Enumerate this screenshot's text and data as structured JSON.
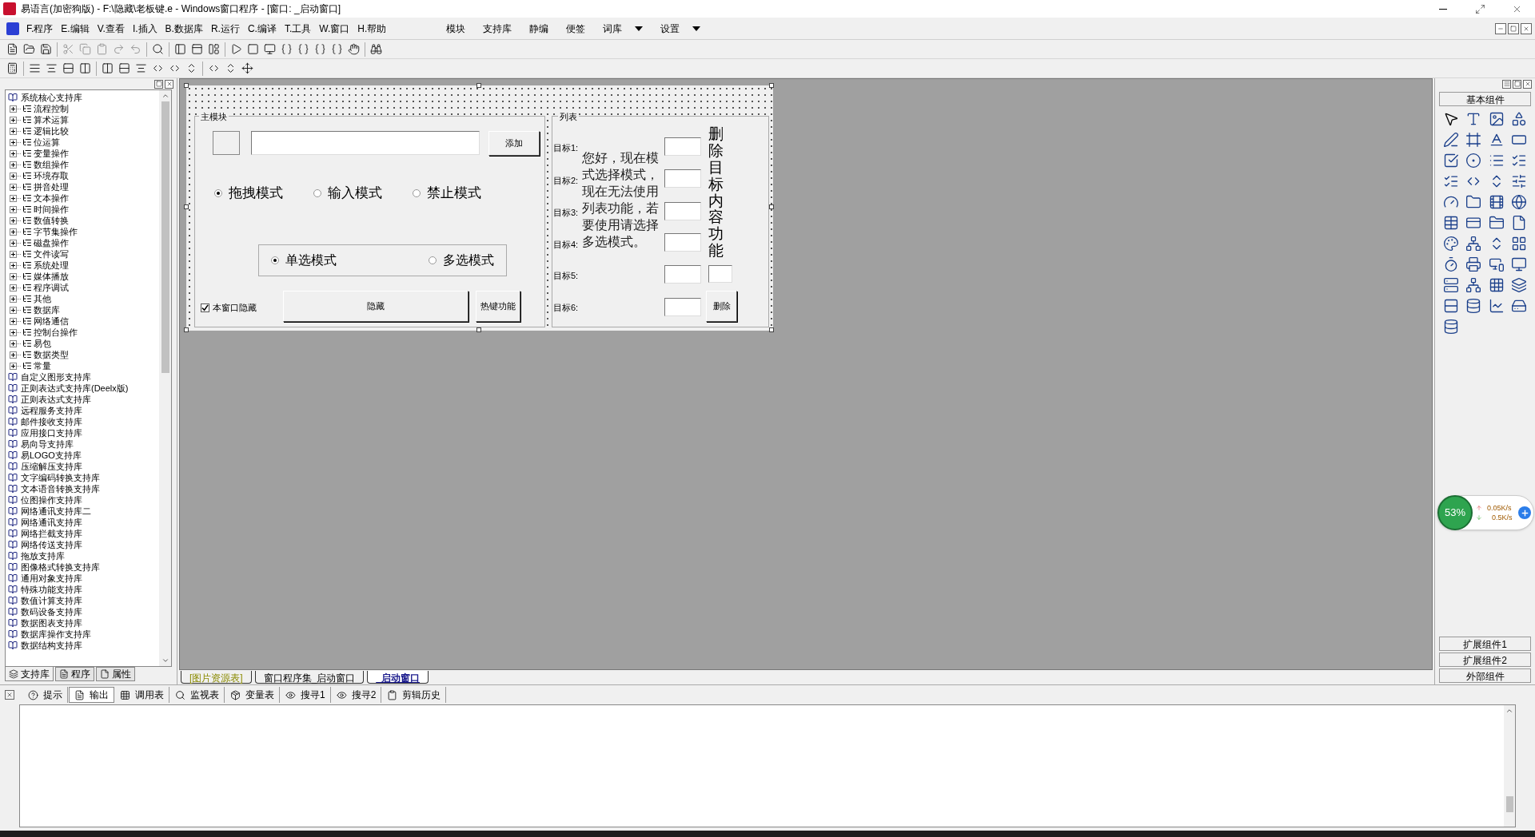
{
  "window": {
    "title": "易语言(加密狗版) - F:\\隐藏\\老板键.e - Windows窗口程序 - [窗口: _启动窗口]"
  },
  "menu": [
    "F.程序",
    "E.编辑",
    "V.查看",
    "I.插入",
    "B.数据库",
    "R.运行",
    "C.编译",
    "T.工具",
    "W.窗口",
    "H.帮助"
  ],
  "menu_right": [
    {
      "label": "模块",
      "dropdown": false
    },
    {
      "label": "支持库",
      "dropdown": false
    },
    {
      "label": "静编",
      "dropdown": false
    },
    {
      "label": "便签",
      "dropdown": false
    },
    {
      "label": "词库",
      "dropdown": true
    },
    {
      "label": "设置",
      "dropdown": true
    }
  ],
  "left_panel": {
    "tree": [
      {
        "label": "系统核心支持库",
        "children": [
          {
            "label": "流程控制",
            "expanded": false
          },
          {
            "label": "算术运算",
            "expanded": false
          },
          {
            "label": "逻辑比较",
            "expanded": false
          },
          {
            "label": "位运算",
            "expanded": false
          },
          {
            "label": "变量操作",
            "expanded": false
          },
          {
            "label": "数组操作",
            "expanded": false
          },
          {
            "label": "环境存取",
            "expanded": false
          },
          {
            "label": "拼音处理",
            "expanded": false
          },
          {
            "label": "文本操作",
            "expanded": false
          },
          {
            "label": "时间操作",
            "expanded": false
          },
          {
            "label": "数值转换",
            "expanded": false
          },
          {
            "label": "字节集操作",
            "expanded": false
          },
          {
            "label": "磁盘操作",
            "expanded": false
          },
          {
            "label": "文件读写",
            "expanded": false
          },
          {
            "label": "系统处理",
            "expanded": false
          },
          {
            "label": "媒体播放",
            "expanded": false
          },
          {
            "label": "程序调试",
            "expanded": false
          },
          {
            "label": "其他",
            "expanded": false
          },
          {
            "label": "数据库",
            "expanded": false
          },
          {
            "label": "网络通信",
            "expanded": false
          },
          {
            "label": "控制台操作",
            "expanded": false
          },
          {
            "label": "易包",
            "expanded": false
          },
          {
            "label": "数据类型",
            "expanded": false
          },
          {
            "label": "常量",
            "expanded": false
          }
        ]
      },
      {
        "label": "自定义图形支持库"
      },
      {
        "label": "正则表达式支持库(Deelx版)"
      },
      {
        "label": "正则表达式支持库"
      },
      {
        "label": "远程服务支持库"
      },
      {
        "label": "邮件接收支持库"
      },
      {
        "label": "应用接口支持库"
      },
      {
        "label": "易向导支持库"
      },
      {
        "label": "易LOGO支持库"
      },
      {
        "label": "压缩解压支持库"
      },
      {
        "label": "文字编码转换支持库"
      },
      {
        "label": "文本语音转换支持库"
      },
      {
        "label": "位图操作支持库"
      },
      {
        "label": "网络通讯支持库二"
      },
      {
        "label": "网络通讯支持库"
      },
      {
        "label": "网络拦截支持库"
      },
      {
        "label": "网络传送支持库"
      },
      {
        "label": "拖放支持库"
      },
      {
        "label": "图像格式转换支持库"
      },
      {
        "label": "通用对象支持库"
      },
      {
        "label": "特殊功能支持库"
      },
      {
        "label": "数值计算支持库"
      },
      {
        "label": "数码设备支持库"
      },
      {
        "label": "数据图表支持库"
      },
      {
        "label": "数据库操作支持库"
      },
      {
        "label": "数据结构支持库"
      }
    ],
    "tabs": [
      {
        "label": "支持库",
        "selected": true
      },
      {
        "label": "程序",
        "selected": false
      },
      {
        "label": "属性",
        "selected": false
      }
    ]
  },
  "form": {
    "main_group": {
      "title": "主模块",
      "add_button": "添加",
      "mode_radios": [
        {
          "label": "拖拽模式",
          "selected": true
        },
        {
          "label": "输入模式",
          "selected": false
        },
        {
          "label": "禁止模式",
          "selected": false
        }
      ],
      "select_radios": [
        {
          "label": "单选模式",
          "selected": true
        },
        {
          "label": "多选模式",
          "selected": false
        }
      ],
      "checkbox": {
        "label": "本窗口隐藏",
        "checked": true
      },
      "hide_button": "隐藏",
      "hotkey_button": "热键功能"
    },
    "list_group": {
      "title": "列表",
      "targets": [
        "目标1:",
        "目标2:",
        "目标3:",
        "目标4:",
        "目标5:",
        "目标6:"
      ],
      "message": "您好，现在模式选择模式，现在无法使用列表功能，若要使用请选择多选模式。",
      "vertical_label": "删除目标内容功能",
      "delete_button": "删除"
    }
  },
  "editor_tabs": [
    {
      "label": "[图片资源表]",
      "selected": false
    },
    {
      "label": "窗口程序集_启动窗口",
      "selected": false
    },
    {
      "label": "_启动窗口",
      "selected": true
    }
  ],
  "toolbox": {
    "title": "基本组件",
    "buttons": [
      "扩展组件1",
      "扩展组件2",
      "外部组件"
    ]
  },
  "network_widget": {
    "percent": "53%",
    "upload": "0.05K/s",
    "download": "0.5K/s"
  },
  "output_panel": {
    "tabs": [
      {
        "label": "提示",
        "selected": false
      },
      {
        "label": "输出",
        "selected": true
      },
      {
        "label": "调用表",
        "selected": false
      },
      {
        "label": "监视表",
        "selected": false
      },
      {
        "label": "变量表",
        "selected": false
      },
      {
        "label": "搜寻1",
        "selected": false
      },
      {
        "label": "搜寻2",
        "selected": false
      },
      {
        "label": "剪辑历史",
        "selected": false
      }
    ]
  }
}
